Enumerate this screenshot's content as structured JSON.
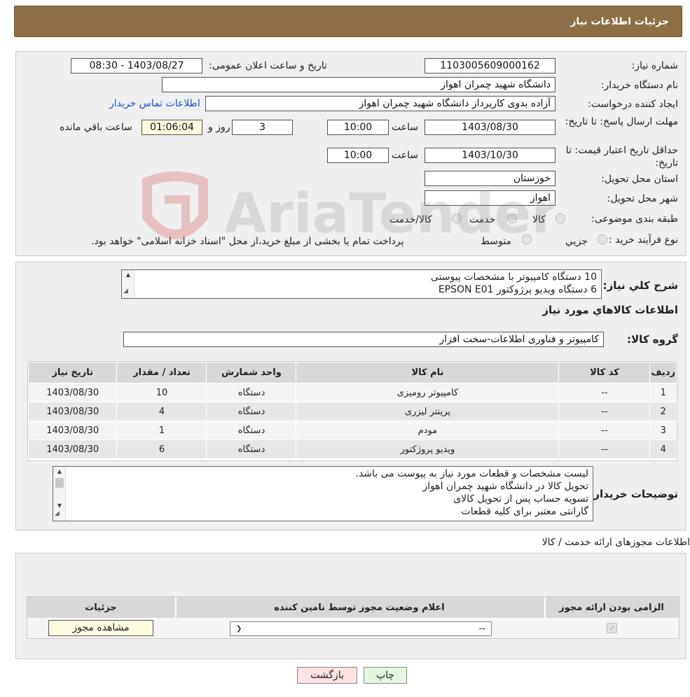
{
  "header": {
    "title": "جزئیات اطلاعات نیاز"
  },
  "form": {
    "need_number_label": "شماره نیاز:",
    "need_number": "1103005609000162",
    "announce_label": "تاریخ و ساعت اعلان عمومی:",
    "announce_value": "1403/08/27 - 08:30",
    "buyer_org_label": "نام دستگاه خریدار:",
    "buyer_org": "دانشگاه شهید چمران اهواز",
    "requester_label": "ایجاد کننده درخواست:",
    "requester": "آزاده بدوی کارپرداز دانشگاه شهید چمران اهواز",
    "contact_link": "اطلاعات تماس خریدار",
    "reply_deadline_label": "مهلت ارسال پاسخ: تا تاریخ:",
    "reply_date": "1403/08/30",
    "time_label": "ساعت",
    "reply_time": "10:00",
    "days_value": "3",
    "days_label": "روز و",
    "remaining_time": "01:06:04",
    "remaining_label": "ساعت باقي مانده",
    "price_validity_label": "حداقل تاریخ اعتبار قیمت: تا تاریخ:",
    "price_date": "1403/10/30",
    "price_time": "10:00",
    "province_label": "استان محل تحویل:",
    "province": "خوزستان",
    "city_label": "شهر محل تحویل:",
    "city": "اهواز",
    "category_label": "طبقه بندی موضوعی:",
    "category_options": [
      "کالا",
      "خدمت",
      "کالا/خدمت"
    ],
    "process_label": "نوع فرآیند خرید :",
    "process_options": [
      "جزيي",
      "متوسط"
    ],
    "process_note": "پرداخت تمام یا بخشی از مبلغ خرید،از محل \"اسناد خزانه اسلامی\" خواهد بود."
  },
  "description": {
    "label": "شرح کلي نياز:",
    "lines": [
      "10 دستگاه کامپیوتر با مشخصات پیوستی",
      "6 دستگاه ویدیو پرژوکتور EPSON E01"
    ]
  },
  "goods": {
    "section_title": "اطلاعات کالاهاي مورد نياز",
    "group_label": "گروه کالا:",
    "group_value": "کامپیوتر و فناوری اطلاعات-سخت افزار",
    "columns": [
      "رديف",
      "کد کالا",
      "نام کالا",
      "واحد شمارش",
      "تعداد / مقدار",
      "تاريخ نياز"
    ],
    "rows": [
      [
        "1",
        "--",
        "کامپیوتر رومیزی",
        "دستگاه",
        "10",
        "1403/08/30"
      ],
      [
        "2",
        "--",
        "پرینتر لیزری",
        "دستگاه",
        "4",
        "1403/08/30"
      ],
      [
        "3",
        "--",
        "مودم",
        "دستگاه",
        "1",
        "1403/08/30"
      ],
      [
        "4",
        "--",
        "ویدیو پروژکتور",
        "دستگاه",
        "6",
        "1403/08/30"
      ]
    ]
  },
  "buyer_notes": {
    "label": "توضيحات خريدار:",
    "lines": [
      "لیست مشخصات و قطعات مورد نیاز به پیوست می باشد.",
      "تحویل کالا در دانشگاه شهید چمران اهواز",
      "تسویه حساب پس از تحویل کالای",
      "گارانتی معتبر برای کلیه قطعات"
    ]
  },
  "permits": {
    "section_title": "اطلاعات مجوزهای ارائه خدمت / کالا",
    "columns": [
      "الزامی بودن ارائه مجوز",
      "اعلام وضعیت مجوز توسط نامین کننده",
      "جزئيات"
    ],
    "select_value": "--",
    "view_button": "مشاهده مجوز"
  },
  "buttons": {
    "print": "چاپ",
    "back": "بازگشت"
  },
  "watermark": {
    "text": "AriaTender.neT"
  },
  "colors": {
    "header": "#8d6f45",
    "link": "#1a4fd6",
    "back_button": "#fde3e3",
    "print_button": "#e6f7df"
  }
}
